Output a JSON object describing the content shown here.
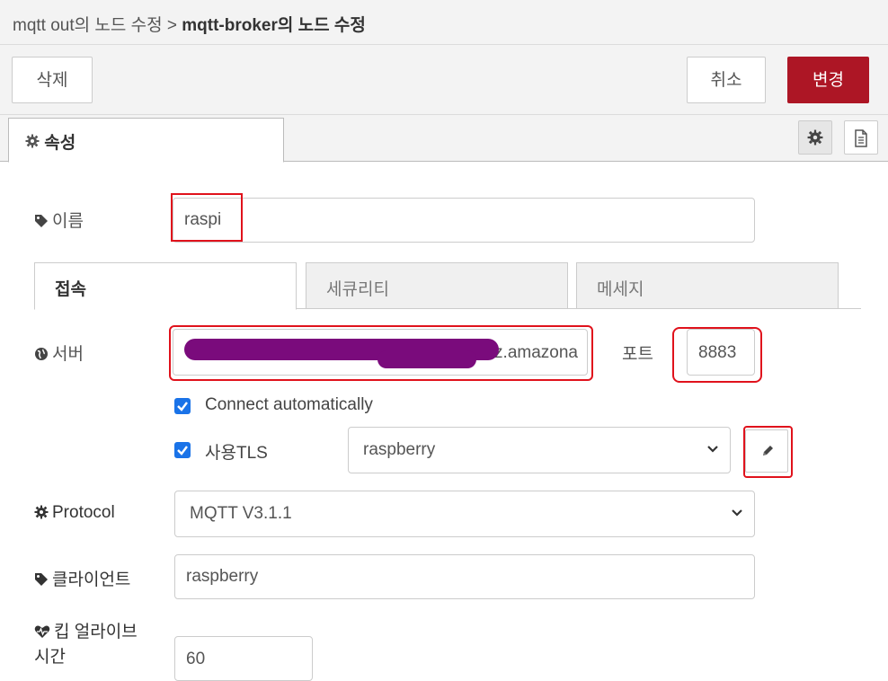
{
  "header": {
    "breadcrumb_parent": "mqtt out의 노드 수정 > ",
    "breadcrumb_current": "mqtt-broker의 노드 수정"
  },
  "toolbar": {
    "delete_label": "삭제",
    "cancel_label": "취소",
    "change_label": "변경"
  },
  "tabs": {
    "properties_label": "속성"
  },
  "form": {
    "name_label": "이름",
    "name_value": "raspi",
    "subtabs": [
      "접속",
      "세큐리티",
      "메세지"
    ],
    "server_label": "서버",
    "server_value_visible": "z.amazona",
    "port_label": "포트",
    "port_value": "8883",
    "connect_auto_label": "Connect automatically",
    "use_tls_label": "사용TLS",
    "tls_value": "raspberry",
    "protocol_label": "Protocol",
    "protocol_value": "MQTT V3.1.1",
    "client_label": "클라이언트",
    "client_value": "raspberry",
    "keepalive_label_line1": "킵 얼라이브",
    "keepalive_label_line2": "시간",
    "keepalive_value": "60"
  },
  "colors": {
    "accent_primary": "#ad1625",
    "checkbox": "#1a73e8",
    "annotation_red": "#e0121c",
    "redaction": "#7a0b7c"
  },
  "icons": [
    "gear-icon",
    "document-icon",
    "tag-icon",
    "globe-icon",
    "chevron-down-icon",
    "pencil-icon",
    "heartbeat-icon",
    "check-icon"
  ]
}
